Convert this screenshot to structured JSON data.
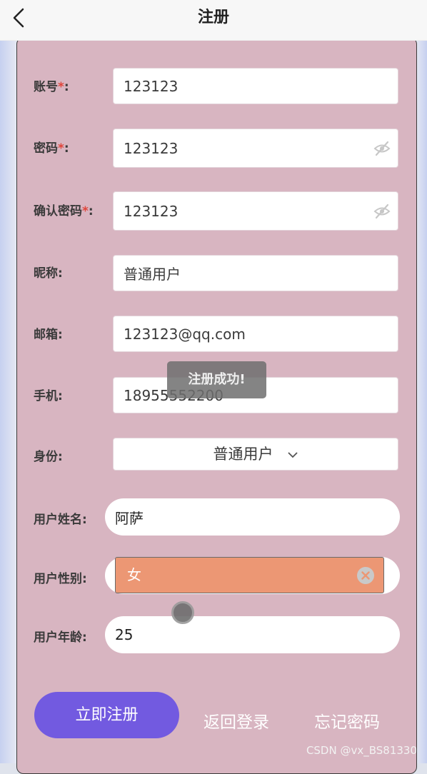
{
  "nav": {
    "title": "注册",
    "back_icon": "chevron-left-icon"
  },
  "form": {
    "account": {
      "label": "账号",
      "required_mark": "*",
      "colon": ":",
      "value": "123123"
    },
    "password": {
      "label": "密码",
      "required_mark": "*",
      "colon": ":",
      "value": "123123",
      "icon": "eye-slash-icon"
    },
    "confirm_password": {
      "label": "确认密码",
      "required_mark": "*",
      "colon": ":",
      "value": "123123",
      "icon": "eye-slash-icon"
    },
    "nickname": {
      "label": "昵称:",
      "value": "普通用户"
    },
    "email": {
      "label": "邮箱:",
      "value": "123123@qq.com"
    },
    "phone": {
      "label": "手机:",
      "value": "18955552200"
    },
    "role": {
      "label": "身份:",
      "value": "普通用户"
    },
    "user_name": {
      "label": "用户姓名:",
      "value": "阿萨"
    },
    "user_gender": {
      "label": "用户性别:",
      "value": "女"
    },
    "user_age": {
      "label": "用户年龄:",
      "value": "25"
    }
  },
  "toast": {
    "text": "注册成功!"
  },
  "actions": {
    "register": "立即注册",
    "back_login": "返回登录",
    "forgot_password": "忘记密码"
  },
  "watermark": "CSDN @vx_BS81330",
  "colors": {
    "card_bg": "#d8b5c1",
    "primary_button": "#725ae0",
    "gender_highlight": "#ec9774",
    "required": "#e0453b"
  }
}
